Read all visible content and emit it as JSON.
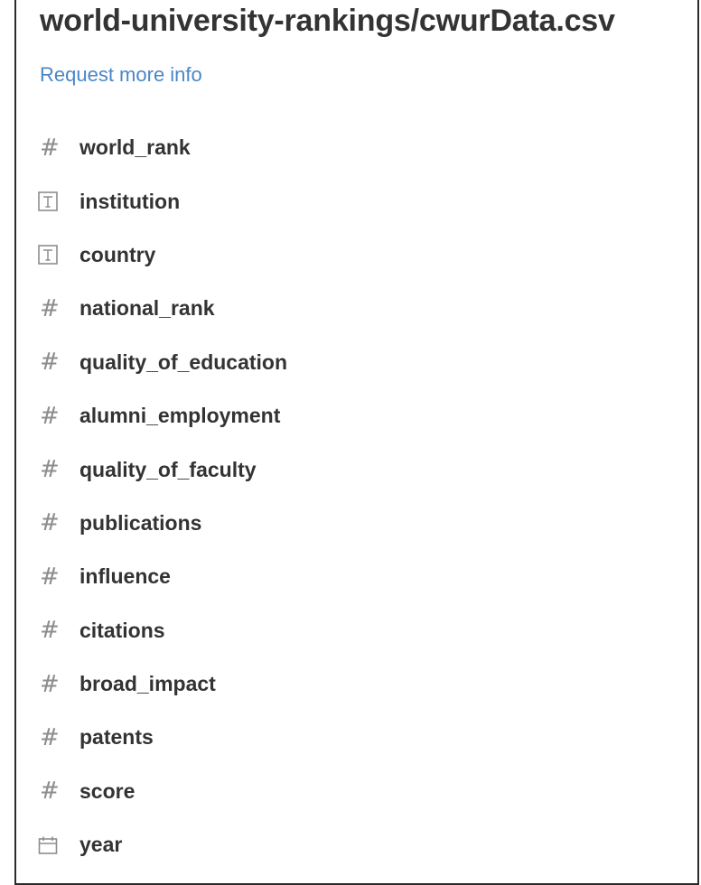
{
  "dataset": {
    "title": "world-university-rankings/cwurData.csv",
    "request_label": "Request more info"
  },
  "columns": [
    {
      "label": "world_rank",
      "icon": "numeric-hash-icon"
    },
    {
      "label": "institution",
      "icon": "text-type-icon"
    },
    {
      "label": "country",
      "icon": "text-type-icon"
    },
    {
      "label": "national_rank",
      "icon": "numeric-hash-icon"
    },
    {
      "label": "quality_of_education",
      "icon": "numeric-hash-icon"
    },
    {
      "label": "alumni_employment",
      "icon": "numeric-hash-icon"
    },
    {
      "label": "quality_of_faculty",
      "icon": "numeric-hash-icon"
    },
    {
      "label": "publications",
      "icon": "numeric-hash-icon"
    },
    {
      "label": "influence",
      "icon": "numeric-hash-icon"
    },
    {
      "label": "citations",
      "icon": "numeric-hash-icon"
    },
    {
      "label": "broad_impact",
      "icon": "numeric-hash-icon"
    },
    {
      "label": "patents",
      "icon": "numeric-hash-icon"
    },
    {
      "label": "score",
      "icon": "numeric-hash-icon"
    },
    {
      "label": "year",
      "icon": "calendar-icon"
    }
  ],
  "colors": {
    "text": "#333333",
    "link": "#4a86c8",
    "icon": "#8d8d8d",
    "border": "#2b2b2b"
  }
}
